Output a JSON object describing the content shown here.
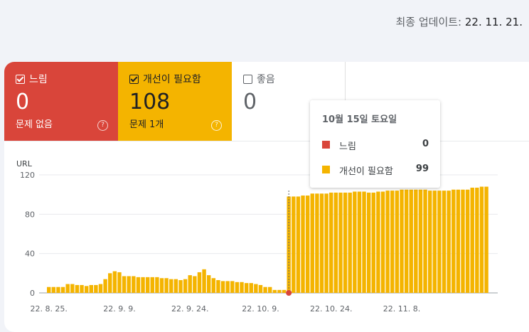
{
  "header": {
    "updated_label": "최종 업데이트:",
    "updated_date": "22. 11. 21."
  },
  "tiles": {
    "slow": {
      "label": "느림",
      "value": "0",
      "sub": "문제 없음",
      "checked": true,
      "color": "#d9453a"
    },
    "needs": {
      "label": "개선이 필요함",
      "value": "108",
      "sub": "문제 1개",
      "checked": true,
      "color": "#f4b400"
    },
    "good": {
      "label": "좋음",
      "value": "0",
      "checked": false
    }
  },
  "help_glyph": "?",
  "tooltip": {
    "title": "10월 15일 토요일",
    "rows": [
      {
        "name": "느림",
        "value": "0",
        "color": "#d9453a"
      },
      {
        "name": "개선이 필요함",
        "value": "99",
        "color": "#f4b400"
      }
    ]
  },
  "chart_data": {
    "type": "bar",
    "ylabel": "URL",
    "ylim": [
      0,
      120
    ],
    "yticks": [
      0,
      40,
      80,
      120
    ],
    "xtick_labels": [
      {
        "label": "22. 8. 25.",
        "index": 0
      },
      {
        "label": "22. 9. 9.",
        "index": 15
      },
      {
        "label": "22. 9. 24.",
        "index": 30
      },
      {
        "label": "22. 10. 9.",
        "index": 45
      },
      {
        "label": "22. 10. 24.",
        "index": 60
      },
      {
        "label": "22. 11. 8.",
        "index": 75
      }
    ],
    "highlight_index": 51,
    "series": [
      {
        "color": "#f4b400",
        "values": [
          6,
          6,
          6,
          6,
          9,
          9,
          8,
          8,
          7,
          8,
          8,
          9,
          14,
          20,
          22,
          21,
          17,
          17,
          17,
          16,
          16,
          16,
          16,
          16,
          15,
          15,
          14,
          14,
          13,
          14,
          18,
          17,
          21,
          24,
          18,
          15,
          13,
          12,
          12,
          12,
          11,
          11,
          10,
          10,
          9,
          8,
          6,
          6,
          3,
          3,
          3,
          98,
          98,
          98,
          99,
          99,
          101,
          101,
          101,
          101,
          102,
          102,
          102,
          102,
          102,
          103,
          103,
          103,
          102,
          102,
          103,
          103,
          104,
          104,
          104,
          105,
          105,
          105,
          105,
          105,
          105,
          104,
          104,
          104,
          104,
          104,
          105,
          105,
          105,
          105,
          107,
          107,
          108,
          108
        ]
      }
    ]
  }
}
